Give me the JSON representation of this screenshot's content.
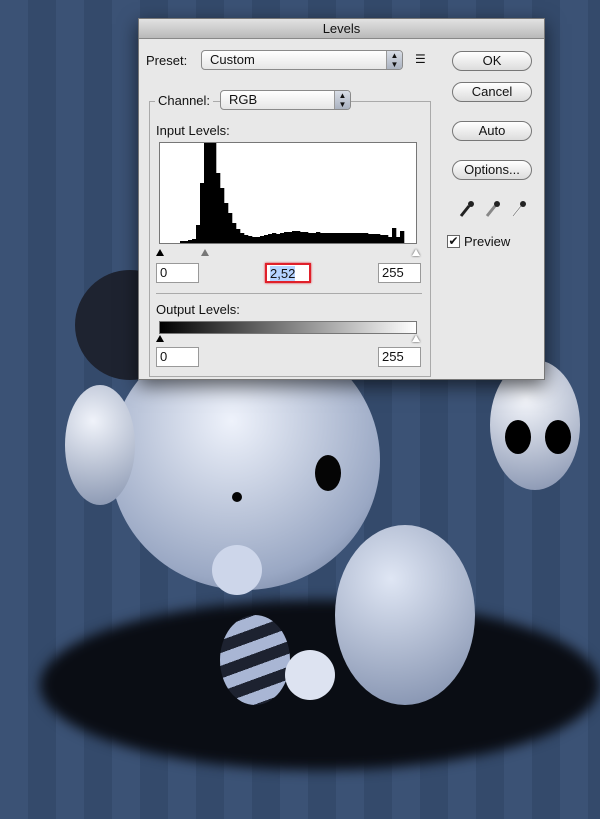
{
  "dialog": {
    "title": "Levels",
    "preset": {
      "label": "Preset:",
      "value": "Custom",
      "menu_icon": "list-menu-icon"
    },
    "channel": {
      "label": "Channel:",
      "value": "RGB"
    },
    "input_levels": {
      "label": "Input Levels:",
      "black": "0",
      "gamma": "2,52",
      "white": "255"
    },
    "output_levels": {
      "label": "Output Levels:",
      "black": "0",
      "white": "255"
    },
    "buttons": {
      "ok": "OK",
      "cancel": "Cancel",
      "auto": "Auto",
      "options": "Options..."
    },
    "eyedroppers": [
      "black-eyedropper-icon",
      "gray-eyedropper-icon",
      "white-eyedropper-icon"
    ],
    "preview": {
      "label": "Preview",
      "checked": true
    },
    "histogram": [
      0,
      0,
      0,
      0,
      0,
      2,
      2,
      3,
      4,
      18,
      60,
      100,
      100,
      100,
      70,
      55,
      40,
      30,
      20,
      14,
      10,
      8,
      7,
      6,
      6,
      7,
      8,
      9,
      10,
      9,
      10,
      11,
      11,
      12,
      12,
      11,
      11,
      10,
      10,
      11,
      10,
      10,
      10,
      10,
      10,
      10,
      10,
      10,
      10,
      10,
      10,
      10,
      9,
      9,
      9,
      8,
      8,
      6,
      15,
      6,
      12,
      0,
      0,
      0
    ]
  }
}
